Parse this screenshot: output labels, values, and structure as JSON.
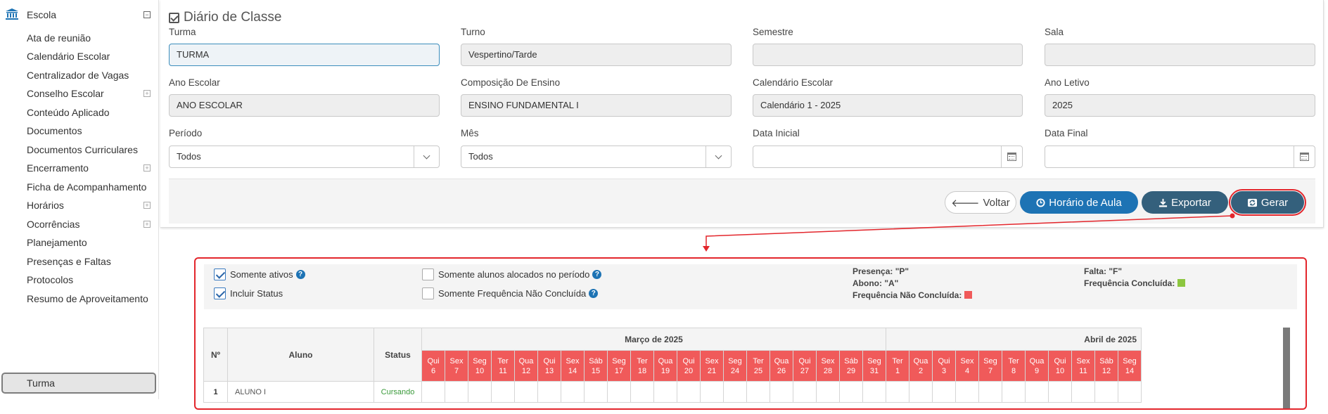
{
  "sidebar": {
    "header": "Escola",
    "items": [
      {
        "label": "Ata de reunião",
        "expand": false
      },
      {
        "label": "Calendário Escolar",
        "expand": false
      },
      {
        "label": "Centralizador de Vagas",
        "expand": false
      },
      {
        "label": "Conselho Escolar",
        "expand": true
      },
      {
        "label": "Conteúdo Aplicado",
        "expand": false
      },
      {
        "label": "Documentos",
        "expand": false
      },
      {
        "label": "Documentos Curriculares",
        "expand": false
      },
      {
        "label": "Encerramento",
        "expand": true
      },
      {
        "label": "Ficha de Acompanhamento",
        "expand": false
      },
      {
        "label": "Horários",
        "expand": true
      },
      {
        "label": "Ocorrências",
        "expand": true
      },
      {
        "label": "Planejamento",
        "expand": false
      },
      {
        "label": "Presenças e Faltas",
        "expand": false
      },
      {
        "label": "Protocolos",
        "expand": false
      },
      {
        "label": "Resumo de Aproveitamento",
        "expand": false
      }
    ],
    "active": "Turma"
  },
  "form": {
    "title": "Diário de Classe",
    "turma": {
      "label": "Turma",
      "value": "TURMA"
    },
    "turno": {
      "label": "Turno",
      "value": "Vespertino/Tarde"
    },
    "semestre": {
      "label": "Semestre",
      "value": ""
    },
    "sala": {
      "label": "Sala",
      "value": ""
    },
    "ano_escolar": {
      "label": "Ano Escolar",
      "value": "ANO ESCOLAR"
    },
    "composicao": {
      "label": "Composição De Ensino",
      "value": "ENSINO FUNDAMENTAL I"
    },
    "calendario": {
      "label": "Calendário Escolar",
      "value": "Calendário 1 - 2025"
    },
    "ano_letivo": {
      "label": "Ano Letivo",
      "value": "2025"
    },
    "periodo": {
      "label": "Período",
      "value": "Todos"
    },
    "mes": {
      "label": "Mês",
      "value": "Todos"
    },
    "data_inicial": {
      "label": "Data Inicial",
      "value": ""
    },
    "data_final": {
      "label": "Data Final",
      "value": ""
    }
  },
  "toolbar": {
    "voltar": "Voltar",
    "horario": "Horário de Aula",
    "exportar": "Exportar",
    "gerar": "Gerar"
  },
  "filters": {
    "somente_ativos": "Somente ativos",
    "incluir_status": "Incluir Status",
    "somente_alocados": "Somente alunos alocados no período",
    "somente_freq": "Somente Frequência Não Concluída"
  },
  "legend": {
    "presenca": "Presença: \"P\"",
    "abono": "Abono: \"A\"",
    "freq_nao": "Frequência Não Concluída:",
    "falta": "Falta: \"F\"",
    "freq_conc": "Frequência Concluída:",
    "color_nao": "#f05a5a",
    "color_conc": "#8cc63f"
  },
  "grid": {
    "col_n": "Nº",
    "col_aluno": "Aluno",
    "col_status": "Status",
    "month1": "Março de 2025",
    "month2": "Abril de 2025",
    "days_march": [
      [
        "Qui",
        "6"
      ],
      [
        "Sex",
        "7"
      ],
      [
        "Seg",
        "10"
      ],
      [
        "Ter",
        "11"
      ],
      [
        "Qua",
        "12"
      ],
      [
        "Qui",
        "13"
      ],
      [
        "Sex",
        "14"
      ],
      [
        "Sáb",
        "15"
      ],
      [
        "Seg",
        "17"
      ],
      [
        "Ter",
        "18"
      ],
      [
        "Qua",
        "19"
      ],
      [
        "Qui",
        "20"
      ],
      [
        "Sex",
        "21"
      ],
      [
        "Seg",
        "24"
      ],
      [
        "Ter",
        "25"
      ],
      [
        "Qua",
        "26"
      ],
      [
        "Qui",
        "27"
      ],
      [
        "Sex",
        "28"
      ],
      [
        "Sáb",
        "29"
      ],
      [
        "Seg",
        "31"
      ]
    ],
    "days_april": [
      [
        "Ter",
        "1"
      ],
      [
        "Qua",
        "2"
      ],
      [
        "Qui",
        "3"
      ],
      [
        "Sex",
        "4"
      ],
      [
        "Seg",
        "7"
      ],
      [
        "Ter",
        "8"
      ],
      [
        "Qua",
        "9"
      ],
      [
        "Qui",
        "10"
      ],
      [
        "Sex",
        "11"
      ],
      [
        "Sáb",
        "12"
      ],
      [
        "Seg",
        "14"
      ]
    ],
    "rows": [
      {
        "n": "1",
        "aluno": "ALUNO I",
        "status": "Cursando"
      }
    ]
  }
}
